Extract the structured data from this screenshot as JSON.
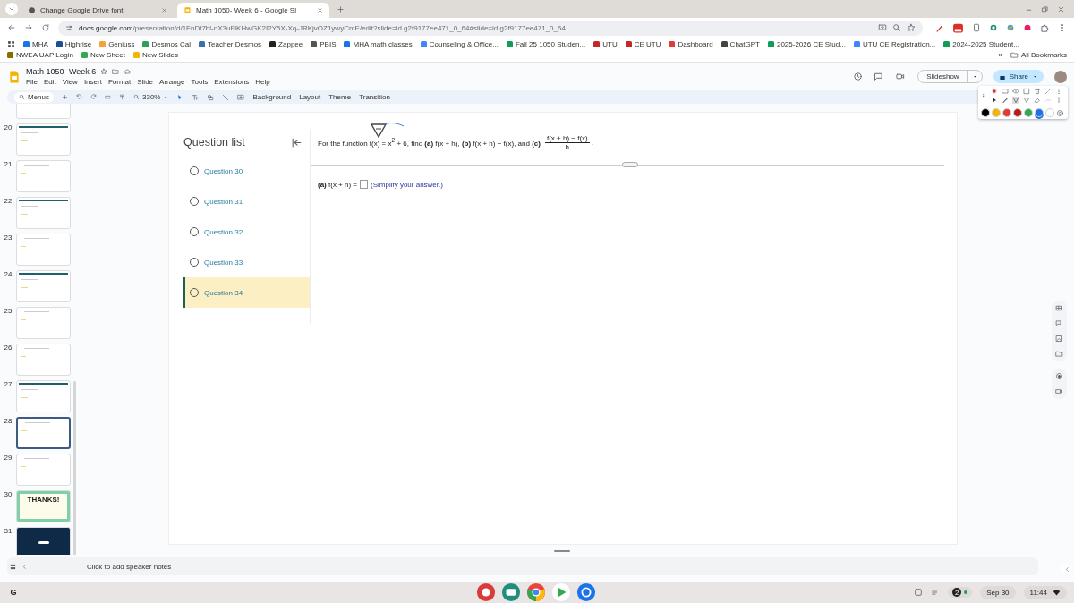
{
  "browser": {
    "tabs": [
      {
        "title": "Change Google Drive font",
        "selected": false
      },
      {
        "title": "Math 1050- Week 6 - Google Sl",
        "selected": true
      }
    ],
    "address": {
      "host": "docs.google.com",
      "path": "/presentation/d/1FnDt7bl-nX3uFlKHwGK2I2Y5X-Xq-JRKjvOZ1ywyCmE/edit?slide=id.g2f9177ee471_0_64#slide=id.g2f9177ee471_0_64"
    },
    "bookmarks": [
      {
        "label": "MHA",
        "color": "#1a73e8"
      },
      {
        "label": "Highrise",
        "color": "#1f4e99"
      },
      {
        "label": "Geniuss",
        "color": "#f2a33a"
      },
      {
        "label": "Desmos Cal",
        "color": "#2e9e5b"
      },
      {
        "label": "Teacher Desmos",
        "color": "#3a6fb0"
      },
      {
        "label": "Zappee",
        "color": "#222222"
      },
      {
        "label": "PBIS",
        "color": "#555555"
      },
      {
        "label": "MHA math classes",
        "color": "#1a73e8"
      },
      {
        "label": "Counseling & Office...",
        "color": "#4285f4"
      },
      {
        "label": "Fall 25 1050 Studen...",
        "color": "#0f9d58"
      },
      {
        "label": "UTU",
        "color": "#c62828"
      },
      {
        "label": "CE UTU",
        "color": "#c62828"
      },
      {
        "label": "Dashboard",
        "color": "#e53935"
      },
      {
        "label": "ChatGPT",
        "color": "#444444"
      },
      {
        "label": "2025-2026 CE Stud...",
        "color": "#0f9d58"
      },
      {
        "label": "UTU CE Registration...",
        "color": "#4285f4"
      },
      {
        "label": "2024-2025 Student...",
        "color": "#0f9d58"
      },
      {
        "label": "NWEA UAP Login",
        "color": "#8a6d00"
      },
      {
        "label": "New Sheet",
        "color": "#34a853"
      },
      {
        "label": "New Slides",
        "color": "#f4b400"
      }
    ],
    "bookmarks_more": "»",
    "all_bookmarks": "All Bookmarks"
  },
  "docs": {
    "title": "Math 1050- Week 6",
    "menus": [
      "File",
      "Edit",
      "View",
      "Insert",
      "Format",
      "Slide",
      "Arrange",
      "Tools",
      "Extensions",
      "Help"
    ],
    "search": "Menus",
    "zoom": "330%",
    "toolbar_buttons": [
      "Background",
      "Layout",
      "Theme",
      "Transition"
    ],
    "slideshow": "Slideshow",
    "share": "Share"
  },
  "palette": {
    "colors": [
      {
        "color": "#000000",
        "selected": false
      },
      {
        "color": "#f4b400",
        "selected": false
      },
      {
        "color": "#e53935",
        "selected": false
      },
      {
        "color": "#b71c1c",
        "selected": false
      },
      {
        "color": "#34a853",
        "selected": false
      },
      {
        "color": "#1a73e8",
        "selected": true
      },
      {
        "color": "#ffffff",
        "selected": false
      }
    ]
  },
  "filmstrip": [
    {
      "kind": "plain",
      "selected": false
    },
    {
      "number": "20",
      "kind": "banner",
      "selected": false
    },
    {
      "number": "21",
      "kind": "plain",
      "selected": false
    },
    {
      "number": "22",
      "kind": "banner",
      "selected": false
    },
    {
      "number": "23",
      "kind": "plain",
      "selected": false
    },
    {
      "number": "24",
      "kind": "banner",
      "selected": false
    },
    {
      "number": "25",
      "kind": "plain",
      "selected": false
    },
    {
      "number": "26",
      "kind": "plain",
      "selected": false
    },
    {
      "number": "27",
      "kind": "banner",
      "selected": false
    },
    {
      "number": "28",
      "kind": "plain",
      "selected": true
    },
    {
      "number": "29",
      "kind": "plain",
      "selected": false
    },
    {
      "number": "30",
      "kind": "thanks",
      "selected": false,
      "text": "THANKS!"
    },
    {
      "number": "31",
      "kind": "dark",
      "selected": false
    }
  ],
  "slide": {
    "question_list": {
      "title": "Question list",
      "items": [
        {
          "label": "Question 30",
          "selected": false
        },
        {
          "label": "Question 31",
          "selected": false
        },
        {
          "label": "Question 32",
          "selected": false
        },
        {
          "label": "Question 33",
          "selected": false
        },
        {
          "label": "Question 34",
          "selected": true
        }
      ]
    },
    "question": {
      "text": "For the function f(x) = x$^{2}$ + 6, find **(a)** f(x + h), **(b)** f(x + h) − f(x), and **(c)**",
      "numerator": "f(x + h) − f(x)",
      "denominator": "h",
      "end": "."
    },
    "answer": {
      "label": "**(a)** f(x + h) =",
      "hint": "(Simplify your answer.)"
    }
  },
  "notes": {
    "placeholder": "Click to add speaker notes"
  },
  "shelf": {
    "launcher": "G",
    "badge": "2",
    "date": "Sep 30",
    "time": "11:44"
  }
}
